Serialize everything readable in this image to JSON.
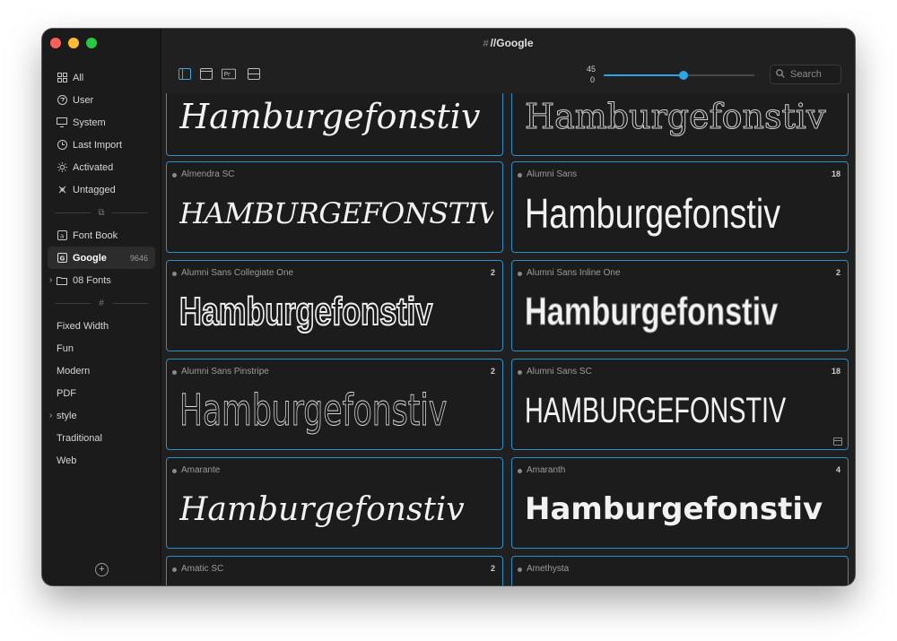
{
  "window": {
    "title": "//Google",
    "title_prefix": "#"
  },
  "sidebar": {
    "smart": [
      {
        "label": "All",
        "icon": "grid-icon"
      },
      {
        "label": "User",
        "icon": "user-circle-icon"
      },
      {
        "label": "System",
        "icon": "monitor-icon"
      },
      {
        "label": "Last Import",
        "icon": "clock-icon"
      },
      {
        "label": "Activated",
        "icon": "sun-icon"
      },
      {
        "label": "Untagged",
        "icon": "untagged-icon"
      }
    ],
    "libraries": [
      {
        "label": "Font Book",
        "icon": "font-book-icon"
      },
      {
        "label": "Google",
        "icon": "google-library-icon",
        "count": "9646"
      },
      {
        "label": "08 Fonts",
        "icon": "folder-icon"
      }
    ],
    "tags": [
      "Fixed Width",
      "Fun",
      "Modern",
      "PDF",
      "style",
      "Traditional",
      "Web"
    ]
  },
  "toolbar": {
    "size_value": "45",
    "size_min": "0",
    "slider_fraction": 0.53,
    "search_placeholder": "Search"
  },
  "sample_text": "Hamburgefonstiv",
  "cards": [
    {
      "name": "",
      "count": ""
    },
    {
      "name": "",
      "count": ""
    },
    {
      "name": "Almendra SC",
      "count": ""
    },
    {
      "name": "Alumni Sans",
      "count": "18"
    },
    {
      "name": "Alumni Sans Collegiate One",
      "count": "2"
    },
    {
      "name": "Alumni Sans Inline One",
      "count": "2"
    },
    {
      "name": "Alumni Sans Pinstripe",
      "count": "2"
    },
    {
      "name": "Alumni Sans SC",
      "count": "18"
    },
    {
      "name": "Amarante",
      "count": ""
    },
    {
      "name": "Amaranth",
      "count": "4"
    },
    {
      "name": "Amatic SC",
      "count": "2"
    },
    {
      "name": "Amethysta",
      "count": ""
    }
  ],
  "colors": {
    "accent": "#2b8fc9",
    "slider": "#2fa4e7"
  }
}
